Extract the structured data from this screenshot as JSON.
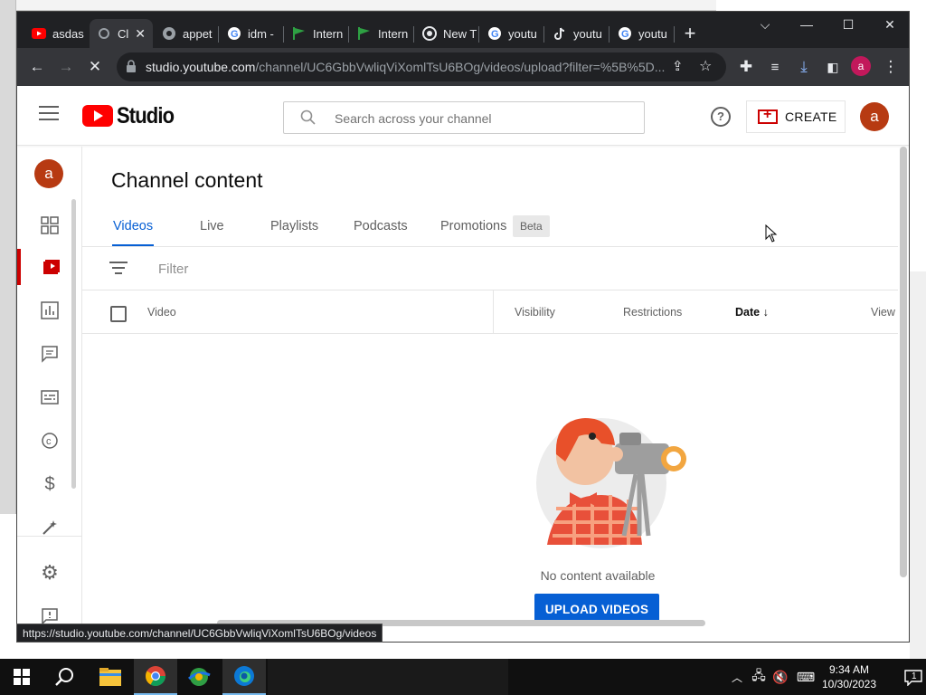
{
  "browser": {
    "tabs": [
      {
        "title": "asdas",
        "favicon": "youtube-icon"
      },
      {
        "title": "Cl",
        "favicon": "studio-icon",
        "active": true
      },
      {
        "title": "appet",
        "favicon": "globe-icon"
      },
      {
        "title": "idm -",
        "favicon": "google-icon"
      },
      {
        "title": "Intern",
        "favicon": "green-flag-icon"
      },
      {
        "title": "Intern",
        "favicon": "green-flag-icon"
      },
      {
        "title": "New T",
        "favicon": "chrome-icon"
      },
      {
        "title": "youtu",
        "favicon": "google-icon"
      },
      {
        "title": "youtu",
        "favicon": "tiktok-icon"
      },
      {
        "title": "youtu",
        "favicon": "google-icon"
      }
    ],
    "url_host": "studio.youtube.com",
    "url_path": "/channel/UC6GbbVwliqViXomlTsU6BOg/videos/upload?filter=%5B%5D...",
    "profile_initial": "a",
    "status_url": "https://studio.youtube.com/channel/UC6GbbVwliqViXomlTsU6BOg/videos"
  },
  "studio": {
    "logo_text": "Studio",
    "search_placeholder": "Search across your channel",
    "create_label": "CREATE",
    "avatar_initial": "a",
    "page_title": "Channel content",
    "tabs": [
      "Videos",
      "Live",
      "Playlists",
      "Podcasts",
      "Promotions"
    ],
    "beta_label": "Beta",
    "filter_label": "Filter",
    "columns": [
      "Video",
      "Visibility",
      "Restrictions",
      "Date",
      "View"
    ],
    "empty_text": "No content available",
    "upload_label": "UPLOAD VIDEOS",
    "accent_color": "#065fd4",
    "brand_red": "#ff0000"
  },
  "taskbar": {
    "time": "9:34 AM",
    "date": "10/30/2023",
    "notification_count": "1"
  }
}
